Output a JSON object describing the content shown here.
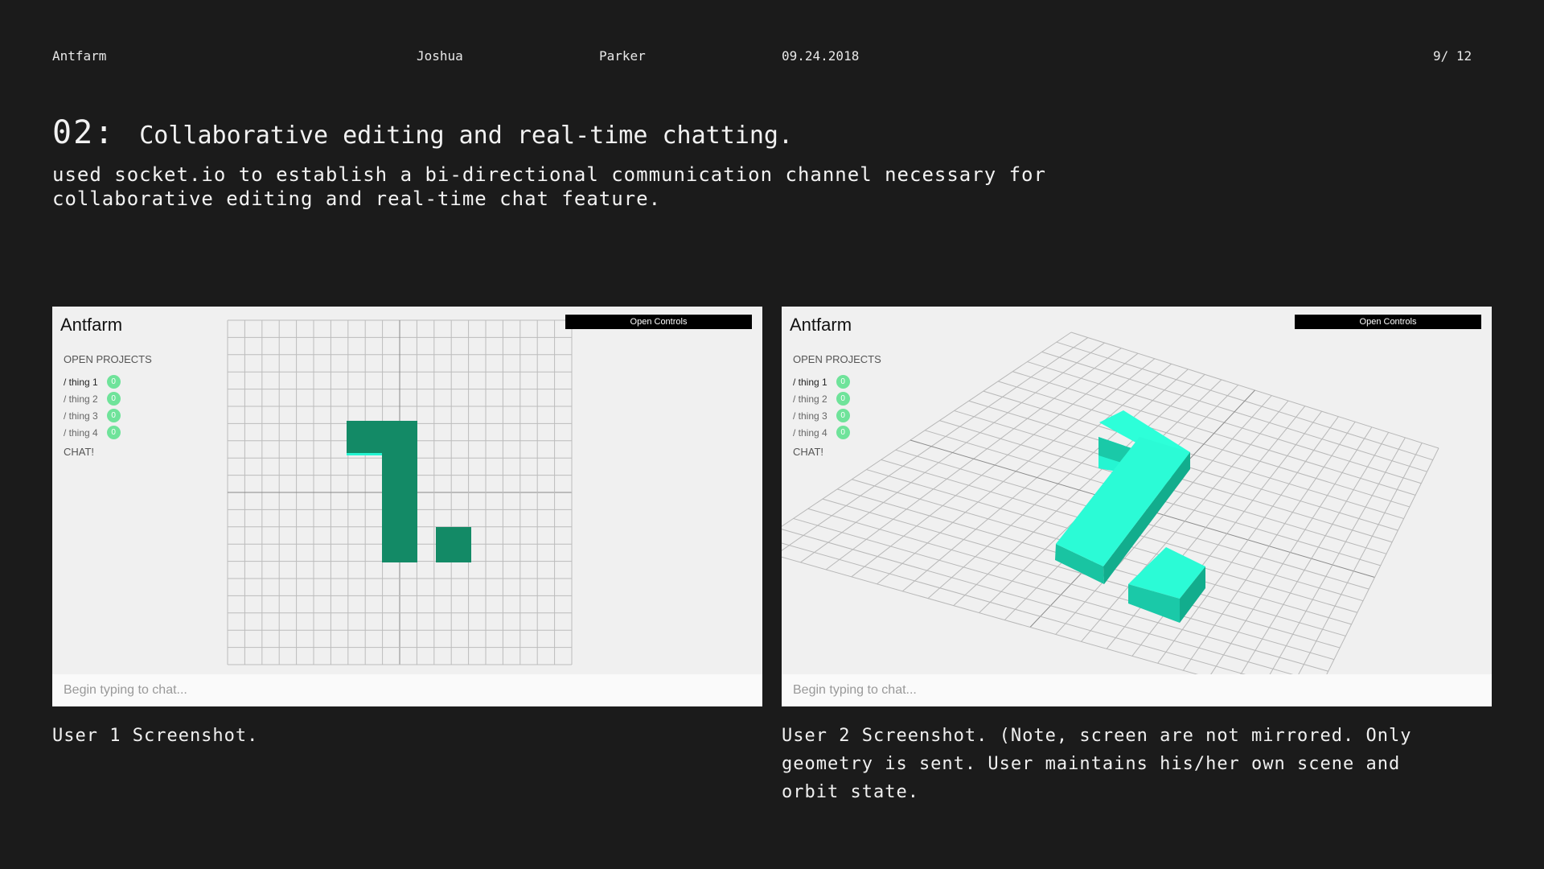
{
  "header": {
    "brand": "Antfarm",
    "first_name": "Joshua",
    "last_name": "Parker",
    "date": "09.24.2018",
    "page": "9/ 12"
  },
  "section": {
    "number": "02:",
    "title": "Collaborative editing and real-time chatting.",
    "description": "used socket.io to establish a bi-directional communication channel necessary for collaborative editing and real-time chat feature."
  },
  "app": {
    "logo": "Antfarm",
    "open_controls": "Open Controls",
    "open_projects_heading": "OPEN PROJECTS",
    "projects": [
      {
        "label": "/ thing 1",
        "count": "0"
      },
      {
        "label": "/ thing 2",
        "count": "0"
      },
      {
        "label": "/ thing 3",
        "count": "0"
      },
      {
        "label": "/ thing 4",
        "count": "0"
      }
    ],
    "chat_label": "CHAT!",
    "chat_placeholder": "Begin typing to chat..."
  },
  "captions": {
    "user1": "User 1 Screenshot.",
    "user2": "User 2 Screenshot. (Note, screen are not mirrored. Only geometry is sent. User maintains his/her own scene and orbit state."
  },
  "colors": {
    "dark_green": "#138a66",
    "cyan": "#25f5d2",
    "badge": "#6fe39a"
  }
}
